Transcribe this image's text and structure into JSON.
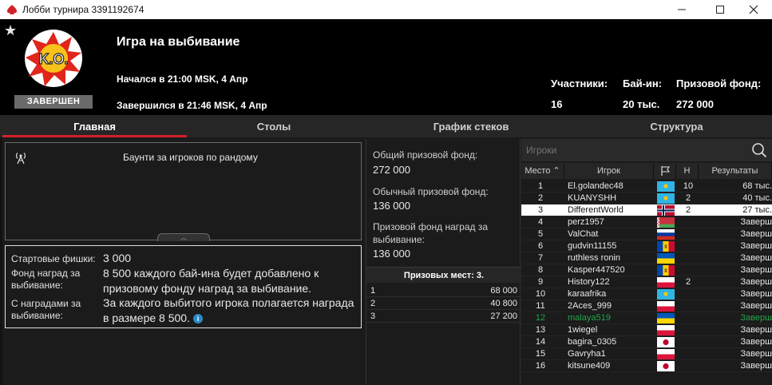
{
  "window": {
    "title": "Лобби турнира 3391192674"
  },
  "header": {
    "game_title": "Игра на выбивание",
    "started": "Начался в 21:00 MSK, 4 Апр",
    "ended": "Завершился в 21:46 MSK, 4 Апр",
    "status": "ЗАВЕРШЕН",
    "badge_text": "K.O.",
    "stats": [
      {
        "label": "Участники:",
        "value": "16"
      },
      {
        "label": "Бай-ин:",
        "value": "20 тыс."
      },
      {
        "label": "Призовой фонд:",
        "value": "272 000"
      }
    ]
  },
  "tabs": [
    "Главная",
    "Столы",
    "График стеков",
    "Структура"
  ],
  "info": {
    "bounty_text": "Баунти за игроков по рандому",
    "details": [
      {
        "label": "Стартовые фишки:",
        "value": "3 000"
      },
      {
        "label": "Фонд наград за выбивание:",
        "value": "8 500 каждого бай-ина будет добавлено к призовому фонду наград за выбивание."
      },
      {
        "label": "С наградами за выбивание:",
        "value": "За каждого выбитого игрока полагается награда в размере 8 500."
      }
    ]
  },
  "pools": [
    {
      "label": "Общий призовой фонд:",
      "value": "272 000"
    },
    {
      "label": "Обычный призовой фонд:",
      "value": "136 000"
    },
    {
      "label": "Призовой фонд наград за выбивание:",
      "value": "136 000"
    }
  ],
  "prizes": {
    "header": "Призовых мест: 3.",
    "rows": [
      {
        "place": "1",
        "amount": "68 000"
      },
      {
        "place": "2",
        "amount": "40 800"
      },
      {
        "place": "3",
        "amount": "27 200"
      }
    ]
  },
  "players": {
    "search_placeholder": "Игроки",
    "columns": {
      "place": "Место",
      "player": "Игрок",
      "n": "Н",
      "results": "Результаты"
    },
    "rows": [
      {
        "place": "1",
        "name": "El.golandec48",
        "flag": "kz",
        "n": "10",
        "result": "68 тыс."
      },
      {
        "place": "2",
        "name": "KUANYSHH",
        "flag": "kz",
        "n": "2",
        "result": "40 тыс."
      },
      {
        "place": "3",
        "name": "DifferentWorld",
        "flag": "no",
        "n": "2",
        "result": "27 тыс."
      },
      {
        "place": "4",
        "name": "perz1957",
        "flag": "by",
        "n": "",
        "result": "Заверш"
      },
      {
        "place": "5",
        "name": "ValChat",
        "flag": "ru",
        "n": "",
        "result": "Заверш"
      },
      {
        "place": "6",
        "name": "gudvin11155",
        "flag": "md",
        "n": "",
        "result": "Заверш"
      },
      {
        "place": "7",
        "name": "ruthless ronin",
        "flag": "ua",
        "n": "",
        "result": "Заверш"
      },
      {
        "place": "8",
        "name": "Kasper447520",
        "flag": "md",
        "n": "",
        "result": "Заверш"
      },
      {
        "place": "9",
        "name": "History122",
        "flag": "pl",
        "n": "2",
        "result": "Заверш"
      },
      {
        "place": "10",
        "name": "karaafrika",
        "flag": "kz",
        "n": "",
        "result": "Заверш"
      },
      {
        "place": "11",
        "name": "2Aces_999",
        "flag": "pl",
        "n": "",
        "result": "Заверш"
      },
      {
        "place": "12",
        "name": "malaya519",
        "flag": "ua",
        "n": "",
        "result": "Заверш"
      },
      {
        "place": "13",
        "name": "1wiegel",
        "flag": "pl",
        "n": "",
        "result": "Заверш"
      },
      {
        "place": "14",
        "name": "bagira_0305",
        "flag": "jp",
        "n": "",
        "result": "Заверш"
      },
      {
        "place": "15",
        "name": "Gavryha1",
        "flag": "pl",
        "n": "",
        "result": "Заверш"
      },
      {
        "place": "16",
        "name": "kitsune409",
        "flag": "jp",
        "n": "",
        "result": "Заверш"
      }
    ]
  },
  "colors": {
    "accent": "#d2202a",
    "selected_row": "#ffffff",
    "highlight_player": "#22a64a",
    "info_icon": "#2a8ac8"
  }
}
